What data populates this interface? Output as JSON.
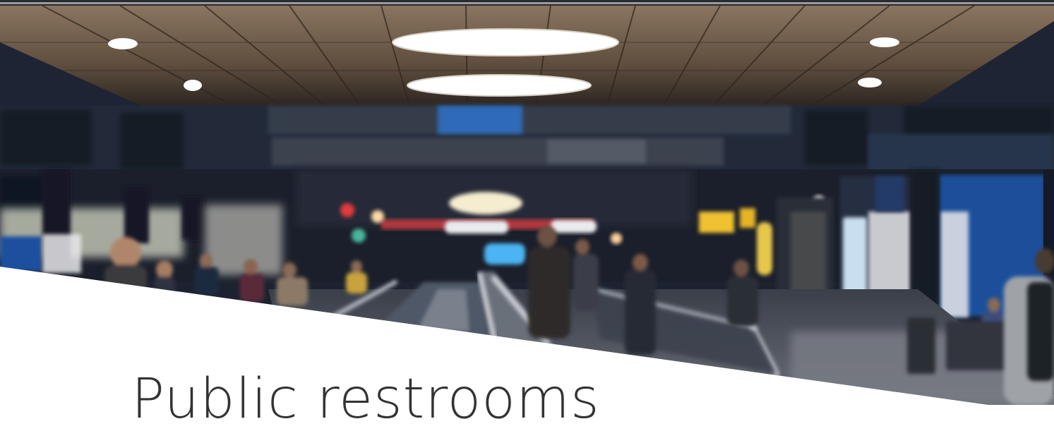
{
  "hero": {
    "image_subject": "blurred airport terminal concourse with moving walkways",
    "title": "Public restrooms"
  },
  "colors": {
    "ceiling": "#6b5a48",
    "concourse_dark": "#1b2233",
    "accent_blue": "#1d4f9a",
    "title_text": "#333333",
    "page_background": "#ffffff"
  }
}
